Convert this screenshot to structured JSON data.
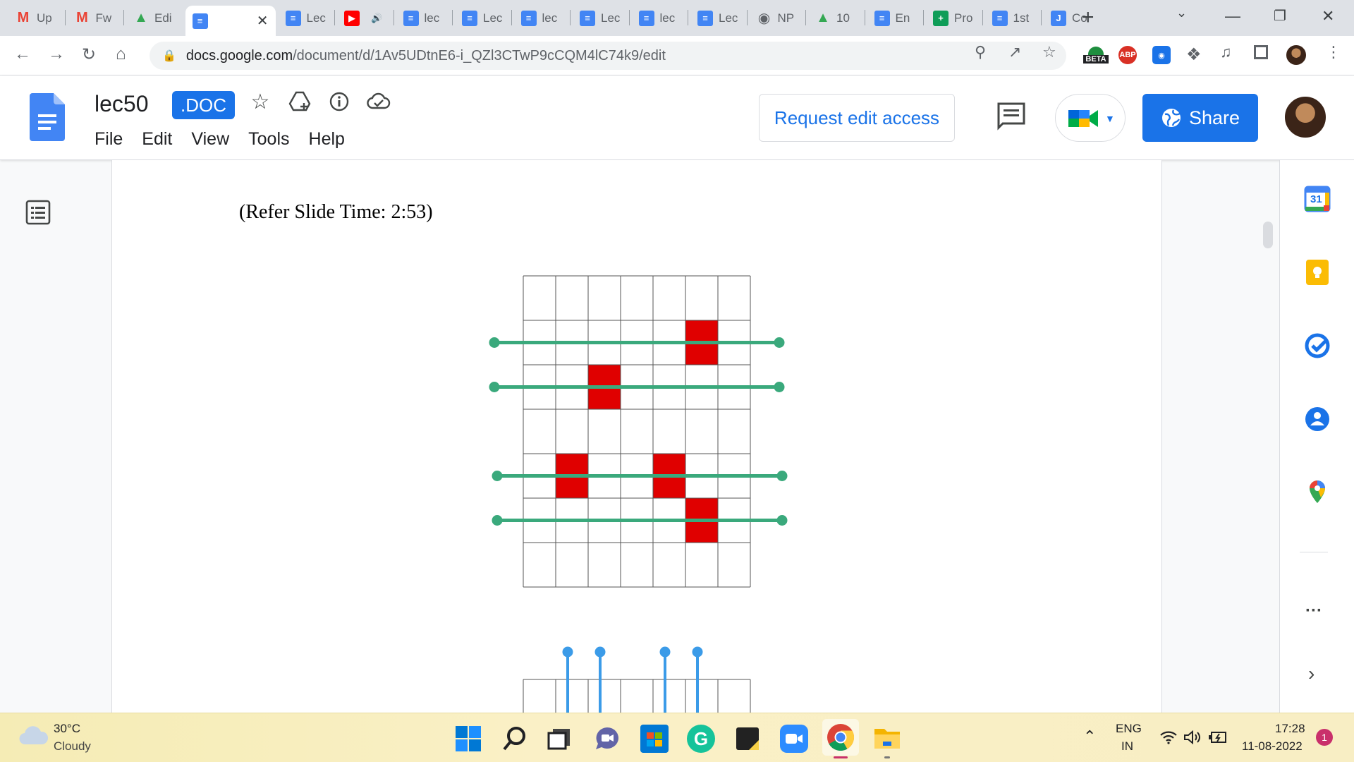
{
  "browser": {
    "tabs": [
      {
        "label": "Up",
        "icon": "gmail-icon",
        "color": "#ea4335"
      },
      {
        "label": "Fw",
        "icon": "gmail-icon",
        "color": "#ea4335"
      },
      {
        "label": "Edi",
        "icon": "drive-icon",
        "color": "#34a853"
      },
      {
        "label": "",
        "icon": "docs-icon",
        "color": "#4285f4",
        "active": true
      },
      {
        "label": "Lec",
        "icon": "docs-icon",
        "color": "#4285f4"
      },
      {
        "label": "",
        "icon": "youtube-icon",
        "color": "#ff0000"
      },
      {
        "label": "lec",
        "icon": "docs-icon",
        "color": "#4285f4"
      },
      {
        "label": "Lec",
        "icon": "docs-icon",
        "color": "#4285f4"
      },
      {
        "label": "lec",
        "icon": "docs-icon",
        "color": "#4285f4"
      },
      {
        "label": "Lec",
        "icon": "docs-icon",
        "color": "#4285f4"
      },
      {
        "label": "lec",
        "icon": "docs-icon",
        "color": "#4285f4"
      },
      {
        "label": "Lec",
        "icon": "docs-icon",
        "color": "#4285f4"
      },
      {
        "label": "NP",
        "icon": "globe-icon",
        "color": "#5f6368"
      },
      {
        "label": "10",
        "icon": "drive-icon",
        "color": "#34a853"
      },
      {
        "label": "En",
        "icon": "docs-icon",
        "color": "#4285f4"
      },
      {
        "label": "Pro",
        "icon": "sheets-icon",
        "color": "#0f9d58"
      },
      {
        "label": "1st",
        "icon": "docs-icon",
        "color": "#4285f4"
      },
      {
        "label": "Co",
        "icon": "jamboard-icon",
        "color": "#4285f4"
      }
    ],
    "url_host": "docs.google.com",
    "url_path": "/document/d/1Av5UDtnE6-i_QZl3CTwP9cCQM4lC74k9/edit",
    "ext_beta_label": "BETA",
    "ext_abp_label": "ABP"
  },
  "docs": {
    "title": "lec50",
    "badge": ".DOC",
    "menu": [
      "File",
      "Edit",
      "View",
      "Tools",
      "Help"
    ],
    "request_label": "Request edit access",
    "share_label": "Share"
  },
  "document": {
    "caption": "(Refer Slide Time: 2:53)",
    "figure": {
      "grid_rows": 7,
      "grid_cols": 7,
      "filled_cells": [
        [
          1,
          5
        ],
        [
          2,
          2
        ],
        [
          4,
          1
        ],
        [
          4,
          4
        ],
        [
          5,
          5
        ]
      ],
      "fill_color": "#e00000",
      "line_color": "#3aa97c",
      "horizontal_lines_at_rows": [
        1,
        2,
        4,
        5
      ],
      "vertical_pins_at_cols": [
        1,
        2,
        4,
        5
      ],
      "pin_color": "#3b9be8"
    }
  },
  "calendar_day": "31",
  "taskbar": {
    "temperature": "30°C",
    "weather": "Cloudy",
    "lang_top": "ENG",
    "lang_bottom": "IN",
    "time": "17:28",
    "date": "11-08-2022",
    "notif_count": "1"
  }
}
